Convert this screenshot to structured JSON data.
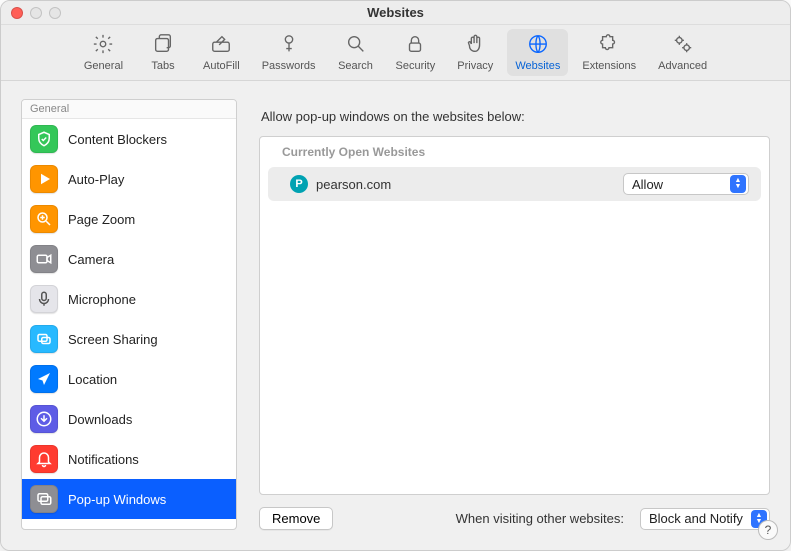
{
  "window": {
    "title": "Websites"
  },
  "toolbar": {
    "items": [
      {
        "label": "General"
      },
      {
        "label": "Tabs"
      },
      {
        "label": "AutoFill"
      },
      {
        "label": "Passwords"
      },
      {
        "label": "Search"
      },
      {
        "label": "Security"
      },
      {
        "label": "Privacy"
      },
      {
        "label": "Websites"
      },
      {
        "label": "Extensions"
      },
      {
        "label": "Advanced"
      }
    ],
    "active_index": 7
  },
  "sidebar": {
    "section": "General",
    "items": [
      {
        "label": "Content Blockers"
      },
      {
        "label": "Auto-Play"
      },
      {
        "label": "Page Zoom"
      },
      {
        "label": "Camera"
      },
      {
        "label": "Microphone"
      },
      {
        "label": "Screen Sharing"
      },
      {
        "label": "Location"
      },
      {
        "label": "Downloads"
      },
      {
        "label": "Notifications"
      },
      {
        "label": "Pop-up Windows"
      }
    ],
    "selected_index": 9,
    "icon_bg": [
      "#34c759",
      "#ff9500",
      "#ff9500",
      "#8e8e93",
      "#e5e5ea",
      "#27b9ff",
      "#007aff",
      "#5e5ce6",
      "#ff3b30",
      "#8e8e93"
    ]
  },
  "pane": {
    "header": "Allow pop-up windows on the websites below:",
    "subheader": "Currently Open Websites",
    "rows": [
      {
        "site": "pearson.com",
        "setting": "Allow",
        "favicon_letter": "P"
      }
    ]
  },
  "footer": {
    "remove": "Remove",
    "label": "When visiting other websites:",
    "default_setting": "Block and Notify"
  },
  "help": "?"
}
